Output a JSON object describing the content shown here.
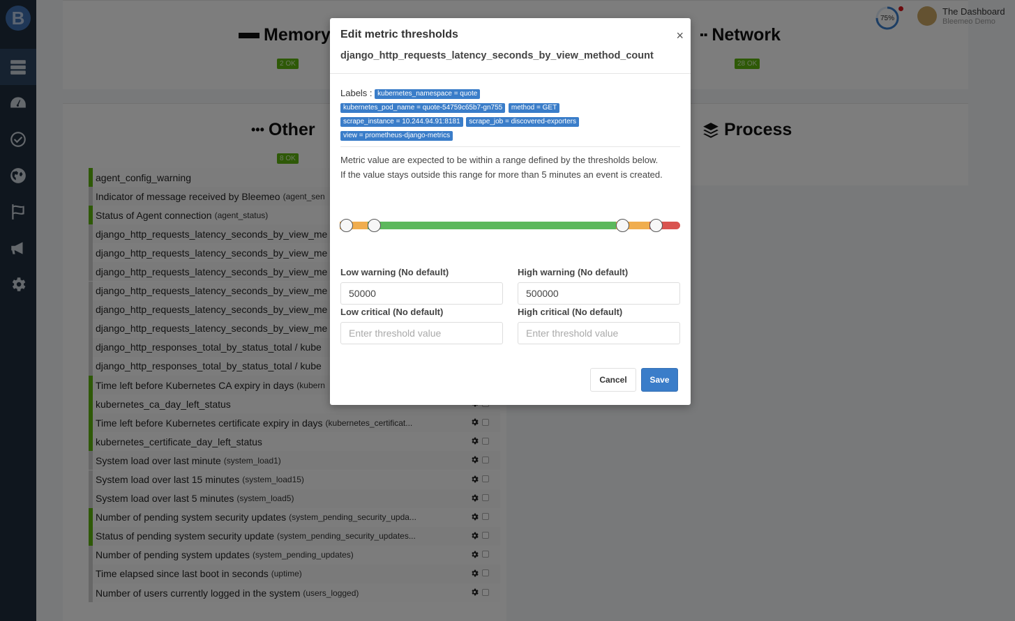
{
  "header": {
    "progress_label": "75%",
    "progress_value": 0.75,
    "account_name": "The Dashboard",
    "account_sub": "Bleemeo Demo"
  },
  "sidebar": {
    "logo": "B",
    "items": [
      {
        "icon": "server-icon",
        "active": true
      },
      {
        "icon": "dashboard-gauge-icon"
      },
      {
        "icon": "check-circle-icon"
      },
      {
        "icon": "globe-icon"
      },
      {
        "icon": "flag-icon"
      },
      {
        "icon": "bullhorn-icon"
      },
      {
        "icon": "gear-icon"
      }
    ]
  },
  "sections": {
    "memory": {
      "title": "Memory",
      "badge": "2 OK"
    },
    "network": {
      "title": "Network",
      "badge": "28 OK"
    },
    "other": {
      "title": "Other",
      "badge": "8 OK"
    },
    "process": {
      "title": "Process"
    }
  },
  "metrics": [
    {
      "name": "agent_config_warning",
      "key": "",
      "status": "ok"
    },
    {
      "name": "Indicator of message received by Bleemeo",
      "key": "(agent_sen",
      "status": "none"
    },
    {
      "name": "Status of Agent connection",
      "key": "(agent_status)",
      "status": "ok"
    },
    {
      "name": "django_http_requests_latency_seconds_by_view_me",
      "key": "",
      "status": "none"
    },
    {
      "name": "django_http_requests_latency_seconds_by_view_me",
      "key": "",
      "status": "none"
    },
    {
      "name": "django_http_requests_latency_seconds_by_view_me",
      "key": "",
      "status": "none"
    },
    {
      "name": "django_http_requests_latency_seconds_by_view_me",
      "key": "",
      "status": "none"
    },
    {
      "name": "django_http_requests_latency_seconds_by_view_me",
      "key": "",
      "status": "none"
    },
    {
      "name": "django_http_requests_latency_seconds_by_view_me",
      "key": "",
      "status": "none"
    },
    {
      "name": "django_http_responses_total_by_status_total  / kube",
      "key": "",
      "status": "none"
    },
    {
      "name": "django_http_responses_total_by_status_total  / kube",
      "key": "",
      "status": "none"
    },
    {
      "name": "Time left before Kubernetes CA expiry in days",
      "key": "(kubern",
      "status": "ok"
    },
    {
      "name": "kubernetes_ca_day_left_status",
      "key": "",
      "status": "ok"
    },
    {
      "name": "Time left before Kubernetes certificate expiry in days",
      "key": "(kubernetes_certificat...",
      "status": "ok"
    },
    {
      "name": "kubernetes_certificate_day_left_status",
      "key": "",
      "status": "ok"
    },
    {
      "name": "System load over last minute",
      "key": "(system_load1)",
      "status": "none"
    },
    {
      "name": "System load over last 15 minutes",
      "key": "(system_load15)",
      "status": "none"
    },
    {
      "name": "System load over last 5 minutes",
      "key": "(system_load5)",
      "status": "none"
    },
    {
      "name": "Number of pending system security updates",
      "key": "(system_pending_security_upda...",
      "status": "ok"
    },
    {
      "name": "Status of pending system security update",
      "key": "(system_pending_security_updates...",
      "status": "ok"
    },
    {
      "name": "Number of pending system updates",
      "key": "(system_pending_updates)",
      "status": "none"
    },
    {
      "name": "Time elapsed since last boot in seconds",
      "key": "(uptime)",
      "status": "none"
    },
    {
      "name": "Number of users currently logged in the system",
      "key": "(users_logged)",
      "status": "none"
    }
  ],
  "modal": {
    "title": "Edit metric thresholds",
    "subtitle": "django_http_requests_latency_seconds_by_view_method_count",
    "close_label": "×",
    "labels_caption": "Labels :",
    "labels": [
      "kubernetes_namespace = quote",
      "kubernetes_pod_name = quote-54759c65b7-gn755",
      "method = GET",
      "scrape_instance = 10.244.94.91:8181",
      "scrape_job = discovered-exporters",
      "view = prometheus-django-metrics"
    ],
    "description_1": "Metric value are expected to be within a range defined by the thresholds below.",
    "description_2": "If the value stays outside this range for more than 5 minutes an event is created.",
    "slider": {
      "colors": {
        "warning": "#f0ad4e",
        "ok": "#5cb85c",
        "critical": "#d9534f"
      },
      "handles_fraction": [
        0.0,
        0.082,
        0.812,
        0.91
      ]
    },
    "fields": {
      "low_warning": {
        "label": "Low warning (No default)",
        "value": "50000",
        "placeholder": "Enter threshold value"
      },
      "high_warning": {
        "label": "High warning (No default)",
        "value": "500000",
        "placeholder": "Enter threshold value"
      },
      "low_critical": {
        "label": "Low critical (No default)",
        "value": "",
        "placeholder": "Enter threshold value"
      },
      "high_critical": {
        "label": "High critical (No default)",
        "value": "",
        "placeholder": "Enter threshold value"
      }
    },
    "cancel_label": "Cancel",
    "save_label": "Save"
  }
}
